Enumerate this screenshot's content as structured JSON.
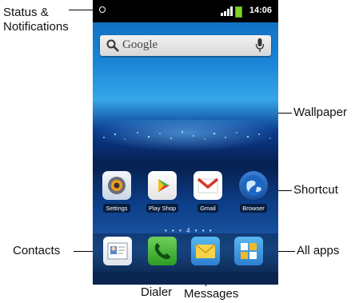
{
  "callouts": {
    "status": [
      "Status &",
      "Notifications"
    ],
    "wallpaper": "Wallpaper",
    "shortcut": "Shortcut",
    "contacts": "Contacts",
    "all_apps": "All apps",
    "dialer": "Dialer",
    "messages": "Messages"
  },
  "statusbar": {
    "time": "14:06"
  },
  "search": {
    "placeholder": "Google"
  },
  "shortcuts": [
    {
      "label": "Settings",
      "icon": "gear-icon"
    },
    {
      "label": "Play Shop",
      "icon": "play-store-icon"
    },
    {
      "label": "Gmail",
      "icon": "gmail-icon"
    },
    {
      "label": "Browser",
      "icon": "globe-icon"
    }
  ],
  "page_indicator": "• • • 4 • • •",
  "dock": [
    {
      "name": "Contacts",
      "icon": "contacts-icon"
    },
    {
      "name": "Dialer",
      "icon": "phone-icon"
    },
    {
      "name": "Messages",
      "icon": "envelope-icon"
    },
    {
      "name": "All apps",
      "icon": "grid-icon"
    }
  ],
  "colors": {
    "statusbar": "#000000",
    "battery": "#7ed321",
    "wallpaper_top": "#1b86d6",
    "wallpaper_dark": "#061f4f"
  }
}
